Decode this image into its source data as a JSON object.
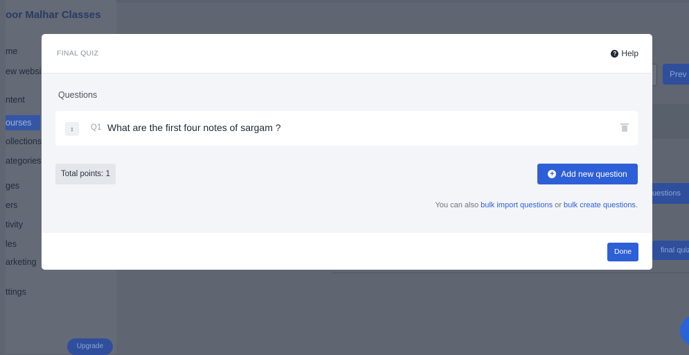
{
  "app": {
    "brand": "oor Malhar Classes"
  },
  "sidebar": {
    "items": [
      {
        "label": "me"
      },
      {
        "label": "ew websi"
      },
      {
        "label": "ntent"
      },
      {
        "label": "ourses",
        "active": true
      },
      {
        "label": "ollections"
      },
      {
        "label": "ategories"
      },
      {
        "label": "ges"
      },
      {
        "label": "ers"
      },
      {
        "label": "tivity"
      },
      {
        "label": "les"
      },
      {
        "label": "arketing"
      },
      {
        "label": "ttings"
      }
    ],
    "upgrade_label": "Upgrade"
  },
  "background": {
    "preview_label": "Prev",
    "questions_label": "uestions",
    "final_quiz_label": "final quiz"
  },
  "modal": {
    "title": "FINAL QUIZ",
    "help_label": "Help",
    "section_label": "Questions",
    "questions": [
      {
        "number": "Q1",
        "text": "What are the first four notes of sargam ?"
      }
    ],
    "total_points": "Total points: 1",
    "add_button_label": "Add new question",
    "import_prefix": "You can also ",
    "import_link_1": "bulk import questions",
    "import_or": " or ",
    "import_link_2": "bulk create questions",
    "import_suffix": ".",
    "done_label": "Done"
  },
  "colors": {
    "accent": "#2d5fd7",
    "overlay": "#5f6672",
    "modal_body": "#f4f5f8"
  },
  "icons": [
    "help-icon",
    "sort-handle-icon",
    "trash-icon",
    "plus-circle-icon"
  ]
}
